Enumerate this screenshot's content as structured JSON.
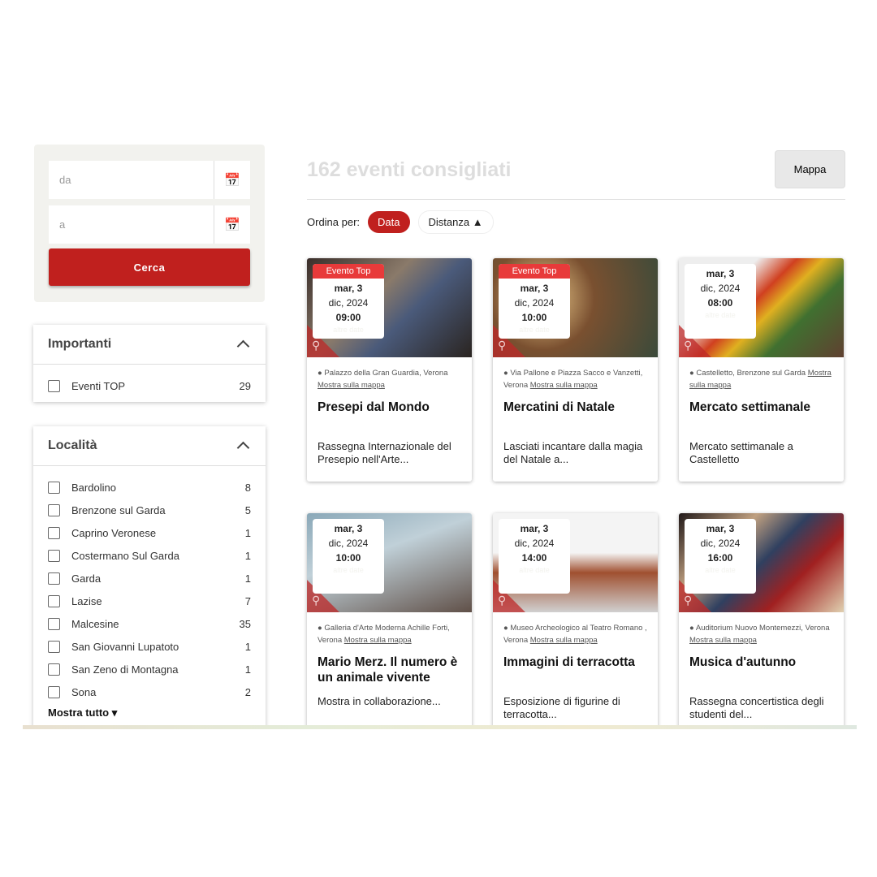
{
  "search": {
    "from_placeholder": "da",
    "to_placeholder": "a",
    "button": "Cerca"
  },
  "filters": [
    {
      "title": "Importanti",
      "items": [
        {
          "label": "Eventi TOP",
          "count": "29"
        }
      ]
    },
    {
      "title": "Località",
      "items": [
        {
          "label": "Bardolino",
          "count": "8"
        },
        {
          "label": "Brenzone sul Garda",
          "count": "5"
        },
        {
          "label": "Caprino Veronese",
          "count": "1"
        },
        {
          "label": "Costermano Sul Garda",
          "count": "1"
        },
        {
          "label": "Garda",
          "count": "1"
        },
        {
          "label": "Lazise",
          "count": "7"
        },
        {
          "label": "Malcesine",
          "count": "35"
        },
        {
          "label": "San Giovanni Lupatoto",
          "count": "1"
        },
        {
          "label": "San Zeno di Montagna",
          "count": "1"
        },
        {
          "label": "Sona",
          "count": "2"
        }
      ],
      "show_all": "Mostra tutto ▾"
    }
  ],
  "header": {
    "title": "162 eventi consigliati",
    "map_button": "Mappa",
    "sort_label": "Ordina per:",
    "sort_data": "Data",
    "sort_distance": "Distanza ▲"
  },
  "map_link": "Mostra sulla mappa",
  "cards": [
    {
      "badge": "Evento Top",
      "day": "mar, 3",
      "month": "dic, 2024",
      "time": "09:00",
      "more": "altre date",
      "location": "Palazzo della Gran Guardia, Verona",
      "title": "Presepi dal Mondo",
      "desc": "Rassegna Internazionale del Presepio nell'Arte..."
    },
    {
      "badge": "Evento Top",
      "day": "mar, 3",
      "month": "dic, 2024",
      "time": "10:00",
      "more": "altre date",
      "location": "Via Pallone e Piazza Sacco e Vanzetti, Verona",
      "title": "Mercatini di Natale",
      "desc": "Lasciati incantare dalla magia del Natale a..."
    },
    {
      "badge": "",
      "day": "mar, 3",
      "month": "dic, 2024",
      "time": "08:00",
      "more": "altre date",
      "location": "Castelletto, Brenzone sul Garda",
      "title": "Mercato settimanale",
      "desc": "Mercato settimanale a Castelletto"
    },
    {
      "badge": "",
      "day": "mar, 3",
      "month": "dic, 2024",
      "time": "10:00",
      "more": "altre date",
      "location": "Galleria d'Arte Moderna Achille Forti, Verona",
      "title": "Mario Merz. Il numero è un animale vivente",
      "desc": "Mostra in collaborazione..."
    },
    {
      "badge": "",
      "day": "mar, 3",
      "month": "dic, 2024",
      "time": "14:00",
      "more": "altre date",
      "location": "Museo Archeologico al Teatro Romano , Verona",
      "title": "Immagini di terracotta",
      "desc": "Esposizione di figurine di terracotta..."
    },
    {
      "badge": "",
      "day": "mar, 3",
      "month": "dic, 2024",
      "time": "16:00",
      "more": "altre date",
      "location": "Auditorium Nuovo Montemezzi, Verona",
      "title": "Musica d'autunno",
      "desc": "Rassegna concertistica degli studenti del..."
    }
  ],
  "colors": {
    "accent": "#c0201e",
    "badge": "#e83a3a"
  }
}
